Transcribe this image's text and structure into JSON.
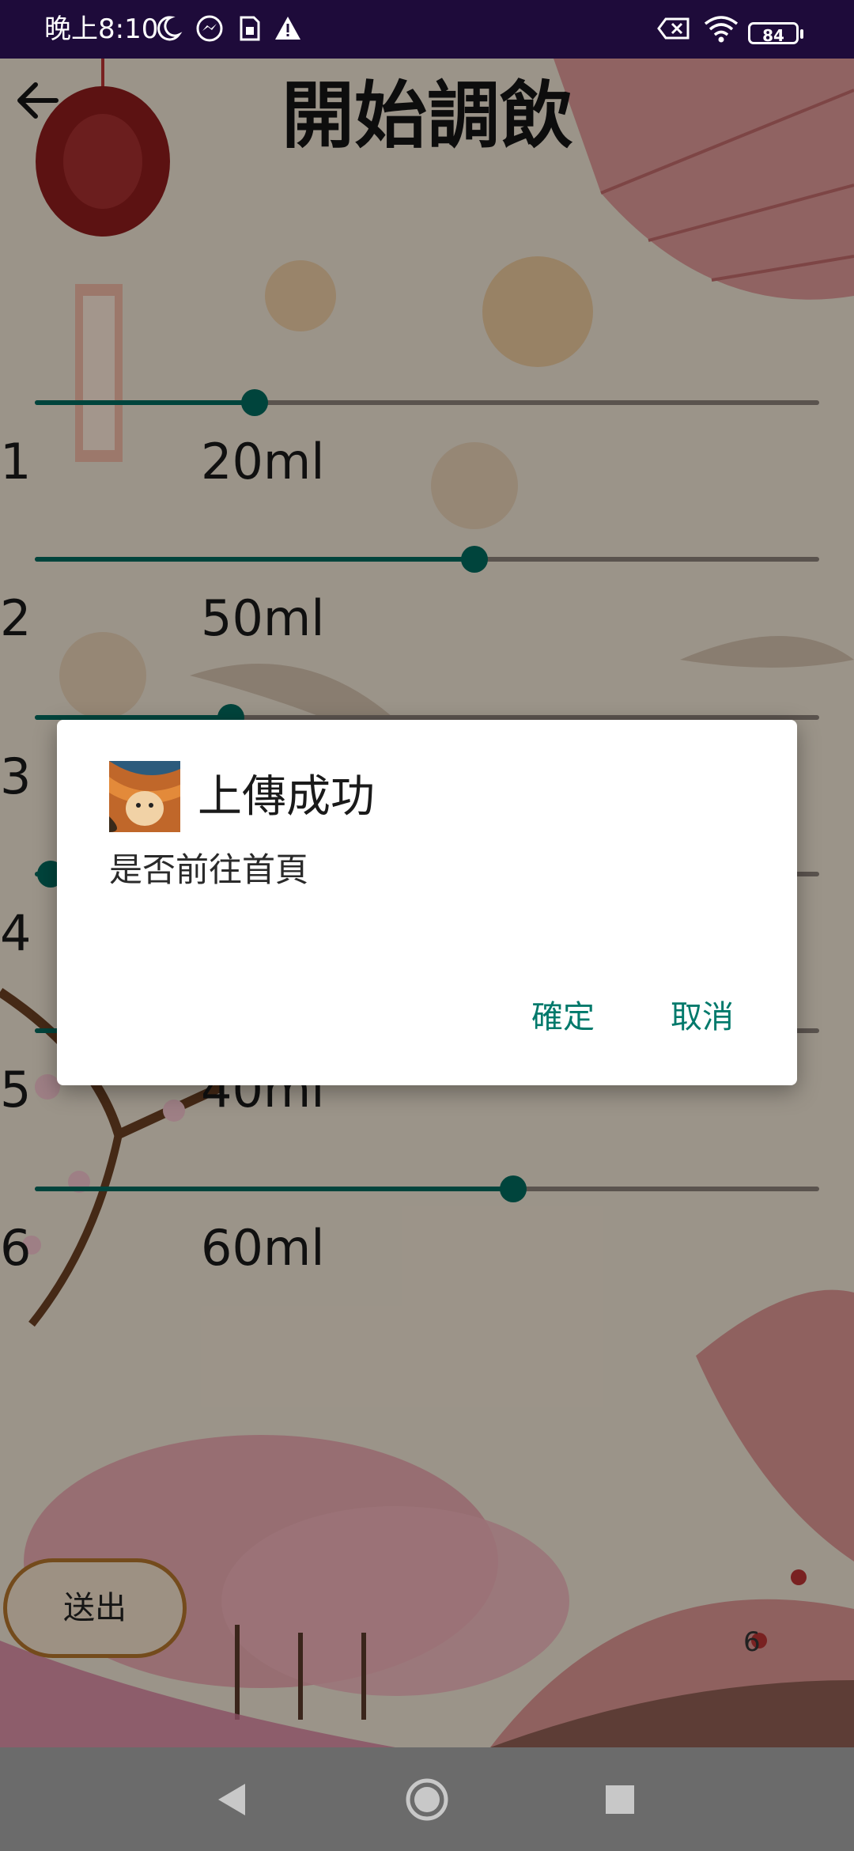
{
  "status_bar": {
    "time": "晚上8:10",
    "battery": "84",
    "icons": [
      "moon-icon",
      "messenger-icon",
      "sim-card-icon",
      "warning-icon",
      "no-sim-icon",
      "wifi-icon",
      "battery-icon"
    ]
  },
  "app_bar": {
    "title": "開始調飲",
    "back_icon": "arrow-left-icon"
  },
  "sliders": [
    {
      "index": "1",
      "amount": "20ml",
      "level": 0.28
    },
    {
      "index": "2",
      "amount": "50ml",
      "level": 0.56
    },
    {
      "index": "3",
      "amount": "",
      "level": 0.25
    },
    {
      "index": "4",
      "amount": "",
      "level": 0.02
    },
    {
      "index": "5",
      "amount": "40ml",
      "level": 0.05
    },
    {
      "index": "6",
      "amount": "60ml",
      "level": 0.61
    }
  ],
  "submit": {
    "label": "送出"
  },
  "bottom_value": "6",
  "dialog": {
    "title": "上傳成功",
    "message": "是否前往首頁",
    "confirm_label": "確定",
    "cancel_label": "取消"
  },
  "colors": {
    "accent": "#00695c",
    "dialog_button": "#00796b",
    "status_bar": "#1e0b3a",
    "nav_bar": "#6b6b6b"
  }
}
